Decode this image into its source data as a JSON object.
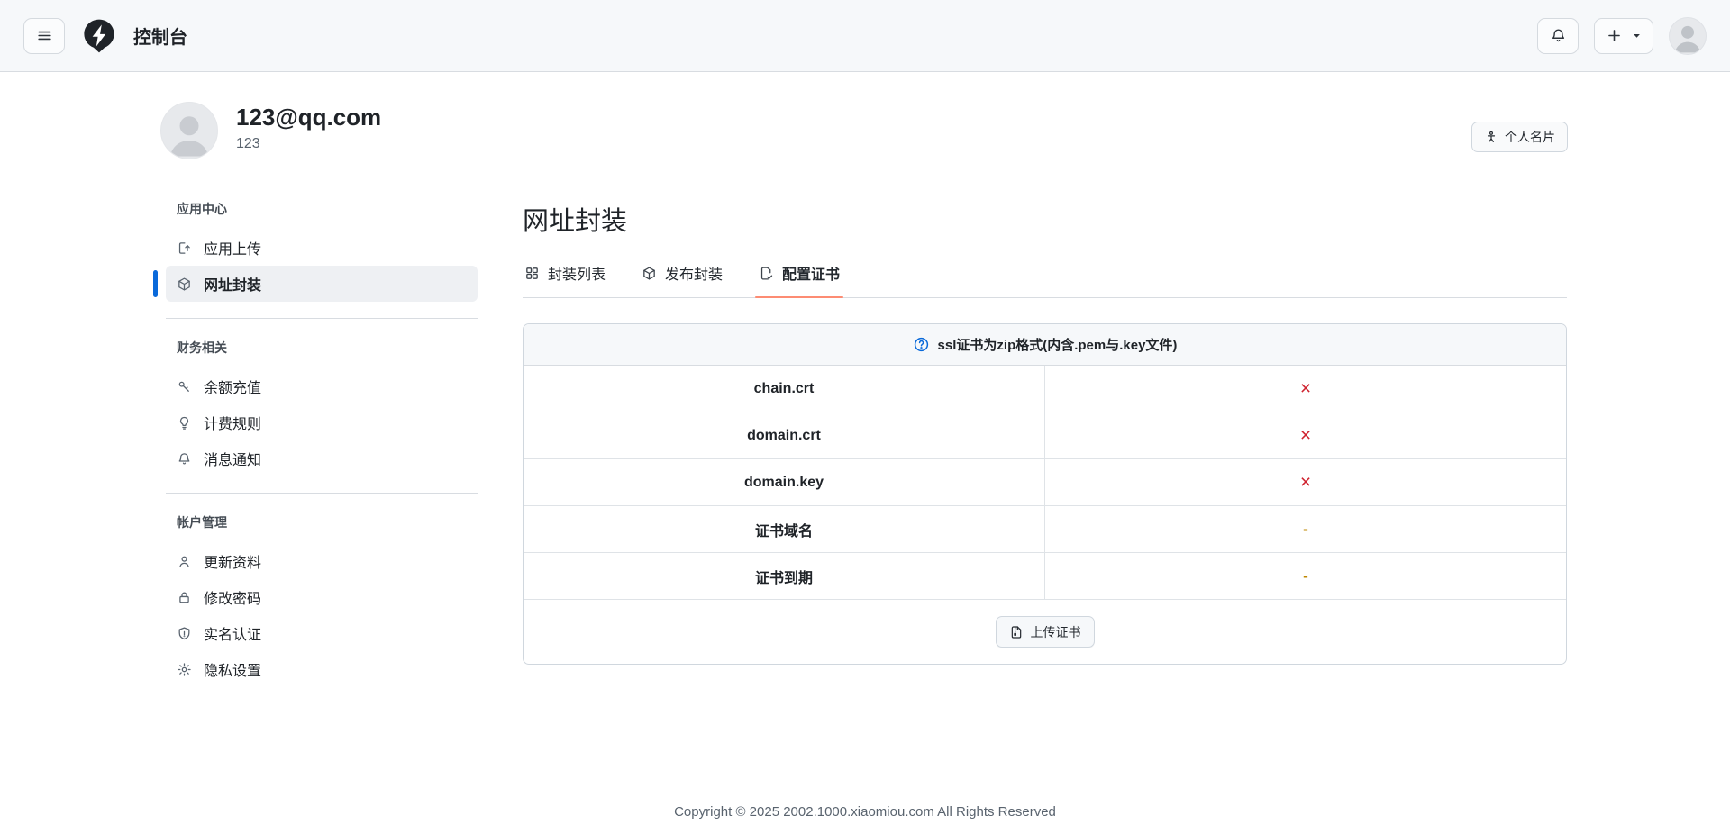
{
  "navbar": {
    "title": "控制台",
    "menu_icon": "hamburger-menu-icon",
    "logo_icon": "lightning-pin-logo",
    "bell_icon": "bell-icon",
    "new_button_icons": [
      "plus-icon",
      "caret-down-icon"
    ],
    "avatar_icon": "user-avatar"
  },
  "profile": {
    "email": "123@qq.com",
    "username": "123",
    "card_button_label": "个人名片",
    "card_button_icon": "person-card-icon"
  },
  "sidebar": {
    "groups": [
      {
        "header": "应用中心",
        "items": [
          {
            "label": "应用上传",
            "icon": "app-upload-icon",
            "active": false
          },
          {
            "label": "网址封装",
            "icon": "package-icon",
            "active": true
          }
        ]
      },
      {
        "header": "财务相关",
        "items": [
          {
            "label": "余额充值",
            "icon": "key-icon",
            "active": false
          },
          {
            "label": "计费规则",
            "icon": "lightbulb-icon",
            "active": false
          },
          {
            "label": "消息通知",
            "icon": "bell-icon",
            "active": false
          }
        ]
      },
      {
        "header": "帐户管理",
        "items": [
          {
            "label": "更新资料",
            "icon": "person-icon",
            "active": false
          },
          {
            "label": "修改密码",
            "icon": "lock-icon",
            "active": false
          },
          {
            "label": "实名认证",
            "icon": "shield-icon",
            "active": false
          },
          {
            "label": "隐私设置",
            "icon": "gear-icon",
            "active": false
          }
        ]
      }
    ]
  },
  "main": {
    "title": "网址封装",
    "tabs": [
      {
        "label": "封装列表",
        "icon": "grid-icon",
        "active": false
      },
      {
        "label": "发布封装",
        "icon": "package-icon",
        "active": false
      },
      {
        "label": "配置证书",
        "icon": "file-check-icon",
        "active": true
      }
    ],
    "cert_table": {
      "hint_icon": "question-circle-icon",
      "hint": "ssl证书为zip格式(内含.pem与.key文件)",
      "rows": [
        {
          "name": "chain.crt",
          "status": "×"
        },
        {
          "name": "domain.crt",
          "status": "×"
        },
        {
          "name": "domain.key",
          "status": "×"
        },
        {
          "name": "证书域名",
          "status": "-"
        },
        {
          "name": "证书到期",
          "status": "-"
        }
      ],
      "upload_button_label": "上传证书",
      "upload_button_icon": "file-zip-icon"
    }
  },
  "footer": {
    "copyright": "Copyright © 2025 2002.1000.xiaomiou.com All Rights Reserved"
  },
  "colors": {
    "accent_blue": "#0969da",
    "danger_red": "#cf222e",
    "attention_yellow": "#bf8700",
    "tab_underline": "#fd8c73",
    "border": "#d0d7de",
    "muted_bg": "#f6f8fa",
    "navbar_bg": "#f6f8fa"
  }
}
